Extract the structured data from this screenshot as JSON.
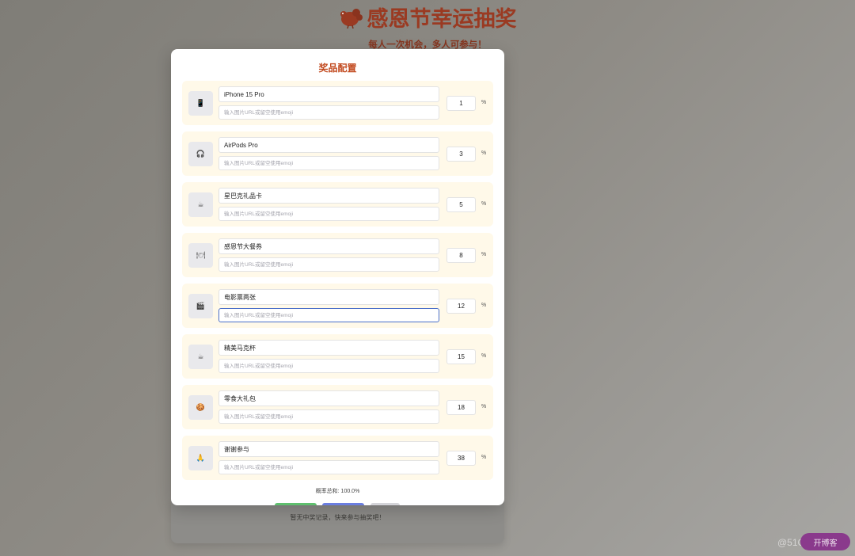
{
  "page": {
    "title": "感恩节幸运抽奖",
    "subtitle": "每人一次机会，多人可参与！",
    "history_empty": "暂无中奖记录，快来参与抽奖吧！",
    "watermark": "@51CTO博客",
    "float_button_label": "开博客"
  },
  "modal": {
    "title": "奖品配置",
    "url_placeholder": "输入图片URL或留空使用emoji",
    "percent_unit": "%",
    "total_label": "概率总和: 100.0%",
    "prizes": [
      {
        "name": "iPhone 15 Pro",
        "icon": "📱",
        "icon_name": "phone-icon",
        "probability": "1",
        "url": ""
      },
      {
        "name": "AirPods Pro",
        "icon": "🎧",
        "icon_name": "headphones-icon",
        "probability": "3",
        "url": ""
      },
      {
        "name": "星巴克礼品卡",
        "icon": "☕",
        "icon_name": "coffee-icon",
        "probability": "5",
        "url": ""
      },
      {
        "name": "感恩节大餐券",
        "icon": "🍽",
        "icon_name": "dinner-icon",
        "probability": "8",
        "url": ""
      },
      {
        "name": "电影票两张",
        "icon": "🎬",
        "icon_name": "clapper-icon",
        "probability": "12",
        "url": ""
      },
      {
        "name": "精美马克杯",
        "icon": "☕",
        "icon_name": "mug-icon",
        "probability": "15",
        "url": ""
      },
      {
        "name": "零食大礼包",
        "icon": "🍪",
        "icon_name": "cookie-icon",
        "probability": "18",
        "url": ""
      },
      {
        "name": "谢谢参与",
        "icon": "🙏",
        "icon_name": "thanks-icon",
        "probability": "38",
        "url": ""
      }
    ],
    "focused_index": 4
  },
  "colors": {
    "title": "#c24a1f",
    "row_bg": "#fff9e9",
    "save_button": "#5fbf6e",
    "reset_button": "#6b7ee0",
    "cancel_button": "#d4d4d8",
    "focus_border": "#4a6fc9"
  }
}
